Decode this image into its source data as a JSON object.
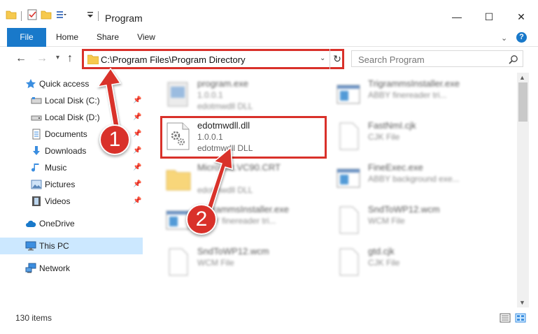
{
  "window": {
    "title": "Program",
    "minimize_glyph": "—",
    "maximize_glyph": "☐",
    "close_glyph": "✕"
  },
  "ribbon": {
    "tabs": [
      "File",
      "Home",
      "Share",
      "View"
    ],
    "help_glyph": "?"
  },
  "address_bar": {
    "path": "C:\\Program Files\\Program Directory"
  },
  "search": {
    "placeholder": "Search Program"
  },
  "sidebar": {
    "items": [
      {
        "label": "Quick access",
        "icon": "star-icon"
      },
      {
        "label": "Local Disk (C:)",
        "icon": "drive-icon"
      },
      {
        "label": "Local Disk (D:)",
        "icon": "drive-icon"
      },
      {
        "label": "Documents",
        "icon": "documents-icon"
      },
      {
        "label": "Downloads",
        "icon": "download-icon"
      },
      {
        "label": "Music",
        "icon": "music-icon"
      },
      {
        "label": "Pictures",
        "icon": "pictures-icon"
      },
      {
        "label": "Videos",
        "icon": "videos-icon"
      },
      {
        "label": "OneDrive",
        "icon": "cloud-icon"
      },
      {
        "label": "This PC",
        "icon": "computer-icon"
      },
      {
        "label": "Network",
        "icon": "network-icon"
      }
    ]
  },
  "files": [
    {
      "name": "program.exe",
      "line2": "1.0.0.1",
      "line3": "edotmwdll DLL",
      "blurred": true
    },
    {
      "name": "TrigrammsInstaller.exe",
      "line2": "ABBY finereader tri...",
      "line3": "",
      "blurred": true
    },
    {
      "name": "edotmwdll.dll",
      "line2": "1.0.0.1",
      "line3": "edotmwdll DLL",
      "blurred": false
    },
    {
      "name": "FastNmI.cjk",
      "line2": "CJK File",
      "line3": "",
      "blurred": true
    },
    {
      "name": "Microsoft.VC90.CRT",
      "line2": "",
      "line3": "edotmwdll DLL",
      "blurred": true
    },
    {
      "name": "FineExec.exe",
      "line2": "ABBY background exe...",
      "line3": "",
      "blurred": true
    },
    {
      "name": "TrigrammsInstaller.exe",
      "line2": "ABBY finereader tri...",
      "line3": "",
      "blurred": true
    },
    {
      "name": "SndToWP12.wcm",
      "line2": "WCM File",
      "line3": "",
      "blurred": true
    },
    {
      "name": "SndToWP12.wcm",
      "line2": "WCM File",
      "line3": "",
      "blurred": true
    },
    {
      "name": "gtd.cjk",
      "line2": "CJK File",
      "line3": "",
      "blurred": true
    }
  ],
  "callouts": [
    "1",
    "2"
  ],
  "status": {
    "item_count": "130 items"
  },
  "colors": {
    "accent": "#1979ca",
    "annotation": "#d9312a",
    "selection": "#cce8ff"
  }
}
